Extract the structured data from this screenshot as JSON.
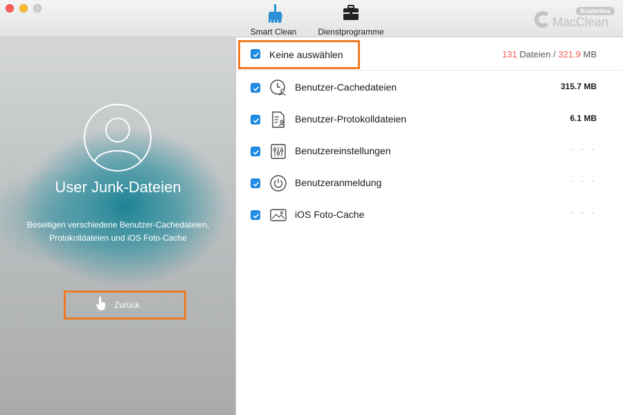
{
  "window": {
    "controls": [
      "close",
      "minimize",
      "maximize"
    ]
  },
  "toolbar": {
    "smart_clean": {
      "label": "Smart Clean",
      "icon": "broom-icon",
      "color": "#2a8fd6"
    },
    "utilities": {
      "label": "Dienstprogramme",
      "icon": "toolbox-icon"
    }
  },
  "brand": {
    "name": "MacClean",
    "badge": "Kostenlos"
  },
  "left_panel": {
    "title": "User Junk-Dateien",
    "description_line1": "Beseitigen verschiedene Benutzer-Cachedateien,",
    "description_line2": "Protokolldateien und iOS Foto-Cache",
    "back_button": "Zurück"
  },
  "summary": {
    "select_label": "Keine auswählen",
    "file_count": "131",
    "files_word": "Dateien",
    "separator": "/",
    "total_size": "321.9",
    "size_unit": "MB"
  },
  "items": [
    {
      "label": "Benutzer-Cachedateien",
      "size": "315.7 MB",
      "icon": "clock-user-icon",
      "checked": true
    },
    {
      "label": "Benutzer-Protokolldateien",
      "size": "6.1 MB",
      "icon": "log-file-icon",
      "checked": true
    },
    {
      "label": "Benutzereinstellungen",
      "size": "- - -",
      "icon": "sliders-icon",
      "checked": true
    },
    {
      "label": "Benutzeranmeldung",
      "size": "- - -",
      "icon": "power-icon",
      "checked": true
    },
    {
      "label": "iOS Foto-Cache",
      "size": "- - -",
      "icon": "photo-icon",
      "checked": true
    }
  ],
  "colors": {
    "accent_orange": "#f07a24",
    "checkbox_blue": "#1f8ee6",
    "stat_red": "#f05a4f"
  }
}
